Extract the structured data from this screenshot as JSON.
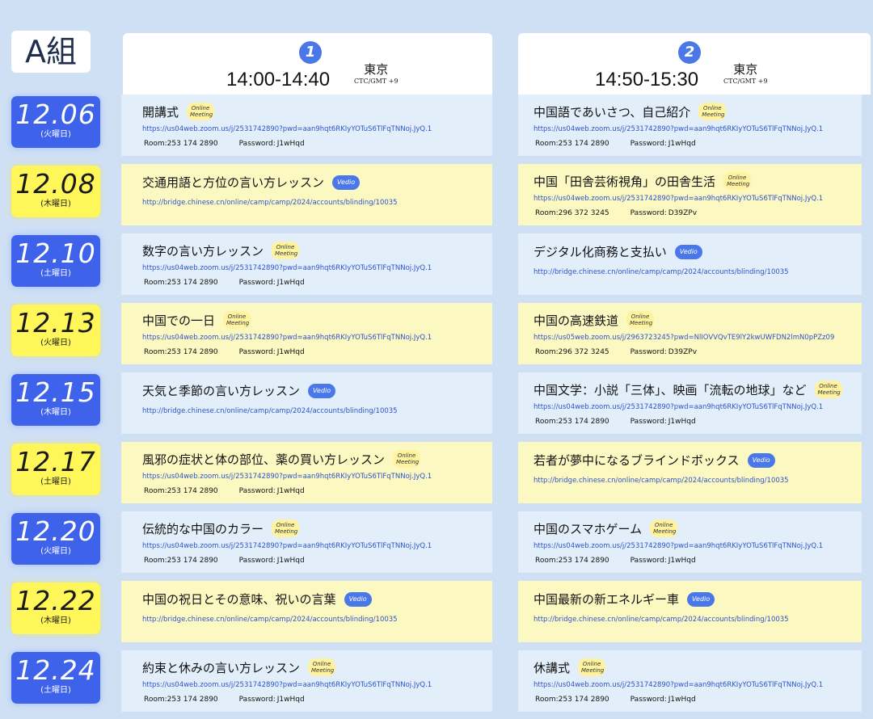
{
  "group_label": "A組",
  "columns": [
    {
      "num": "1",
      "time": "14:00-14:40",
      "city": "東京",
      "tz": "CTC/GMT +9"
    },
    {
      "num": "2",
      "time": "14:50-15:30",
      "city": "東京",
      "tz": "CTC/GMT +9"
    }
  ],
  "colors": {
    "blue_date": "#3e63ea",
    "yellow_date": "#fff65a",
    "link": "#2d53c9",
    "badge_blue": "#4a78e8"
  },
  "labels": {
    "room": "Room:",
    "password": "Password:",
    "online": "Online Meeting",
    "vedio": "Vedio"
  },
  "rows": [
    {
      "date": "12.06",
      "weekday": "(火曜日)",
      "color": "blue",
      "c1": {
        "title": "開講式",
        "type": "online",
        "link": "https://us04web.zoom.us/j/2531742890?pwd=aan9hqt6RKIyYOTuS6TlFqTNNoj.JyQ.1",
        "room": "253 174 2890",
        "password": "J1wHqd"
      },
      "c2": {
        "title": "中国語であいさつ、自己紹介",
        "type": "online",
        "link": "https://us04web.zoom.us/j/2531742890?pwd=aan9hqt6RKIyYOTuS6TlFqTNNoj.JyQ.1",
        "room": "253 174 2890",
        "password": "J1wHqd"
      }
    },
    {
      "date": "12.08",
      "weekday": "(木曜日)",
      "color": "yellow",
      "c1": {
        "title": "交通用語と方位の言い方レッスン",
        "type": "vedio",
        "link": "http://bridge.chinese.cn/online/camp/camp/2024/accounts/blinding/10035",
        "room": "",
        "password": ""
      },
      "c2": {
        "title": "中国「田舎芸術視角」の田舎生活",
        "type": "online",
        "link": "https://us04web.zoom.us/j/2531742890?pwd=aan9hqt6RKIyYOTuS6TlFqTNNoj.JyQ.1",
        "room": "296 372 3245",
        "password": "D39ZPv"
      }
    },
    {
      "date": "12.10",
      "weekday": "(土曜日)",
      "color": "blue",
      "c1": {
        "title": "数字の言い方レッスン",
        "type": "online",
        "link": "https://us04web.zoom.us/j/2531742890?pwd=aan9hqt6RKIyYOTuS6TlFqTNNoj.JyQ.1",
        "room": "253 174 2890",
        "password": "J1wHqd"
      },
      "c2": {
        "title": "デジタル化商務と支払い",
        "type": "vedio",
        "link": "http://bridge.chinese.cn/online/camp/camp/2024/accounts/blinding/10035",
        "room": "",
        "password": ""
      }
    },
    {
      "date": "12.13",
      "weekday": "(火曜日)",
      "color": "yellow",
      "c1": {
        "title": "中国での一日",
        "type": "online",
        "link": "https://us04web.zoom.us/j/2531742890?pwd=aan9hqt6RKIyYOTuS6TlFqTNNoj.JyQ.1",
        "room": "253 174 2890",
        "password": "J1wHqd"
      },
      "c2": {
        "title": "中国の高速鉄道",
        "type": "online",
        "link": "https://us05web.zoom.us/j/2963723245?pwd=NlIOVVQvTE9lY2kwUWFDN2lmN0pPZz09",
        "room": "296 372 3245",
        "password": "D39ZPv"
      }
    },
    {
      "date": "12.15",
      "weekday": "(木曜日)",
      "color": "blue",
      "c1": {
        "title": "天気と季節の言い方レッスン",
        "type": "vedio",
        "link": "http://bridge.chinese.cn/online/camp/camp/2024/accounts/blinding/10035",
        "room": "",
        "password": ""
      },
      "c2": {
        "title": "中国文学：小説「三体」、映画「流転の地球」など",
        "type": "online",
        "link": "https://us04web.zoom.us/j/2531742890?pwd=aan9hqt6RKIyYOTuS6TlFqTNNoj.JyQ.1",
        "room": "253 174 2890",
        "password": "J1wHqd"
      }
    },
    {
      "date": "12.17",
      "weekday": "(土曜日)",
      "color": "yellow",
      "c1": {
        "title": "風邪の症状と体の部位、薬の買い方レッスン",
        "type": "online",
        "link": "https://us04web.zoom.us/j/2531742890?pwd=aan9hqt6RKIyYOTuS6TlFqTNNoj.JyQ.1",
        "room": "253 174 2890",
        "password": "J1wHqd"
      },
      "c2": {
        "title": "若者が夢中になるブラインドボックス",
        "type": "vedio",
        "link": "http://bridge.chinese.cn/online/camp/camp/2024/accounts/blinding/10035",
        "room": "",
        "password": ""
      }
    },
    {
      "date": "12.20",
      "weekday": "(火曜日)",
      "color": "blue",
      "c1": {
        "title": "伝統的な中国のカラー",
        "type": "online",
        "link": "https://us04web.zoom.us/j/2531742890?pwd=aan9hqt6RKIyYOTuS6TlFqTNNoj.JyQ.1",
        "room": "253 174 2890",
        "password": "J1wHqd"
      },
      "c2": {
        "title": "中国のスマホゲーム",
        "type": "online",
        "link": "https://us04web.zoom.us/j/2531742890?pwd=aan9hqt6RKIyYOTuS6TlFqTNNoj.JyQ.1",
        "room": "253 174 2890",
        "password": "J1wHqd"
      }
    },
    {
      "date": "12.22",
      "weekday": "(木曜日)",
      "color": "yellow",
      "c1": {
        "title": "中国の祝日とその意味、祝いの言葉",
        "type": "vedio",
        "link": "http://bridge.chinese.cn/online/camp/camp/2024/accounts/blinding/10035",
        "room": "",
        "password": ""
      },
      "c2": {
        "title": "中国最新の新エネルギー車",
        "type": "vedio",
        "link": "http://bridge.chinese.cn/online/camp/camp/2024/accounts/blinding/10035",
        "room": "",
        "password": ""
      }
    },
    {
      "date": "12.24",
      "weekday": "(土曜日)",
      "color": "blue",
      "c1": {
        "title": "約束と休みの言い方レッスン",
        "type": "online",
        "link": "https://us04web.zoom.us/j/2531742890?pwd=aan9hqt6RKIyYOTuS6TlFqTNNoj.JyQ.1",
        "room": "253 174 2890",
        "password": "J1wHqd"
      },
      "c2": {
        "title": "休講式",
        "type": "online",
        "link": "https://us04web.zoom.us/j/2531742890?pwd=aan9hqt6RKIyYOTuS6TlFqTNNoj.JyQ.1",
        "room": "253 174 2890",
        "password": "J1wHqd"
      }
    }
  ]
}
